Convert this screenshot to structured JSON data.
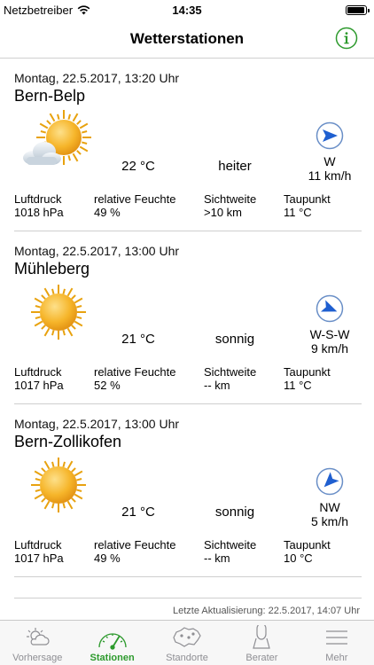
{
  "status": {
    "carrier": "Netzbetreiber",
    "time": "14:35",
    "battery_level": 0.95
  },
  "nav": {
    "title": "Wetterstationen",
    "info_icon": "info-icon",
    "accent": "#2d9a2d"
  },
  "stations": [
    {
      "date": "Montag, 22.5.2017, 13:20 Uhr",
      "name": "Bern-Belp",
      "icon": "sun-cloud-icon",
      "temp": "22 °C",
      "desc": "heiter",
      "wind_dir": "W",
      "wind_speed": "11 km/h",
      "wind_arrow_deg": 0,
      "pressure_label": "Luftdruck",
      "pressure": "1018 hPa",
      "humidity_label": "relative Feuchte",
      "humidity": "49 %",
      "visibility_label": "Sichtweite",
      "visibility": ">10 km",
      "dewpoint_label": "Taupunkt",
      "dewpoint": "11 °C"
    },
    {
      "date": "Montag, 22.5.2017, 13:00 Uhr",
      "name": "Mühleberg",
      "icon": "sun-icon",
      "temp": "21 °C",
      "desc": "sonnig",
      "wind_dir": "W-S-W",
      "wind_speed": "9 km/h",
      "wind_arrow_deg": 22,
      "pressure_label": "Luftdruck",
      "pressure": "1017 hPa",
      "humidity_label": "relative Feuchte",
      "humidity": "52 %",
      "visibility_label": "Sichtweite",
      "visibility": "-- km",
      "dewpoint_label": "Taupunkt",
      "dewpoint": "11 °C"
    },
    {
      "date": "Montag, 22.5.2017, 13:00 Uhr",
      "name": "Bern-Zollikofen",
      "icon": "sun-icon",
      "temp": "21 °C",
      "desc": "sonnig",
      "wind_dir": "NW",
      "wind_speed": "5 km/h",
      "wind_arrow_deg": 135,
      "pressure_label": "Luftdruck",
      "pressure": "1017 hPa",
      "humidity_label": "relative Feuchte",
      "humidity": "49 %",
      "visibility_label": "Sichtweite",
      "visibility": "-- km",
      "dewpoint_label": "Taupunkt",
      "dewpoint": "10 °C"
    }
  ],
  "last_update": "Letzte Aktualisierung: 22.5.2017, 14:07 Uhr",
  "tabs": [
    {
      "label": "Vorhersage",
      "icon": "forecast-icon",
      "active": false
    },
    {
      "label": "Stationen",
      "icon": "stations-icon",
      "active": true
    },
    {
      "label": "Standorte",
      "icon": "map-icon",
      "active": false
    },
    {
      "label": "Berater",
      "icon": "person-icon",
      "active": false
    },
    {
      "label": "Mehr",
      "icon": "menu-icon",
      "active": false
    }
  ]
}
